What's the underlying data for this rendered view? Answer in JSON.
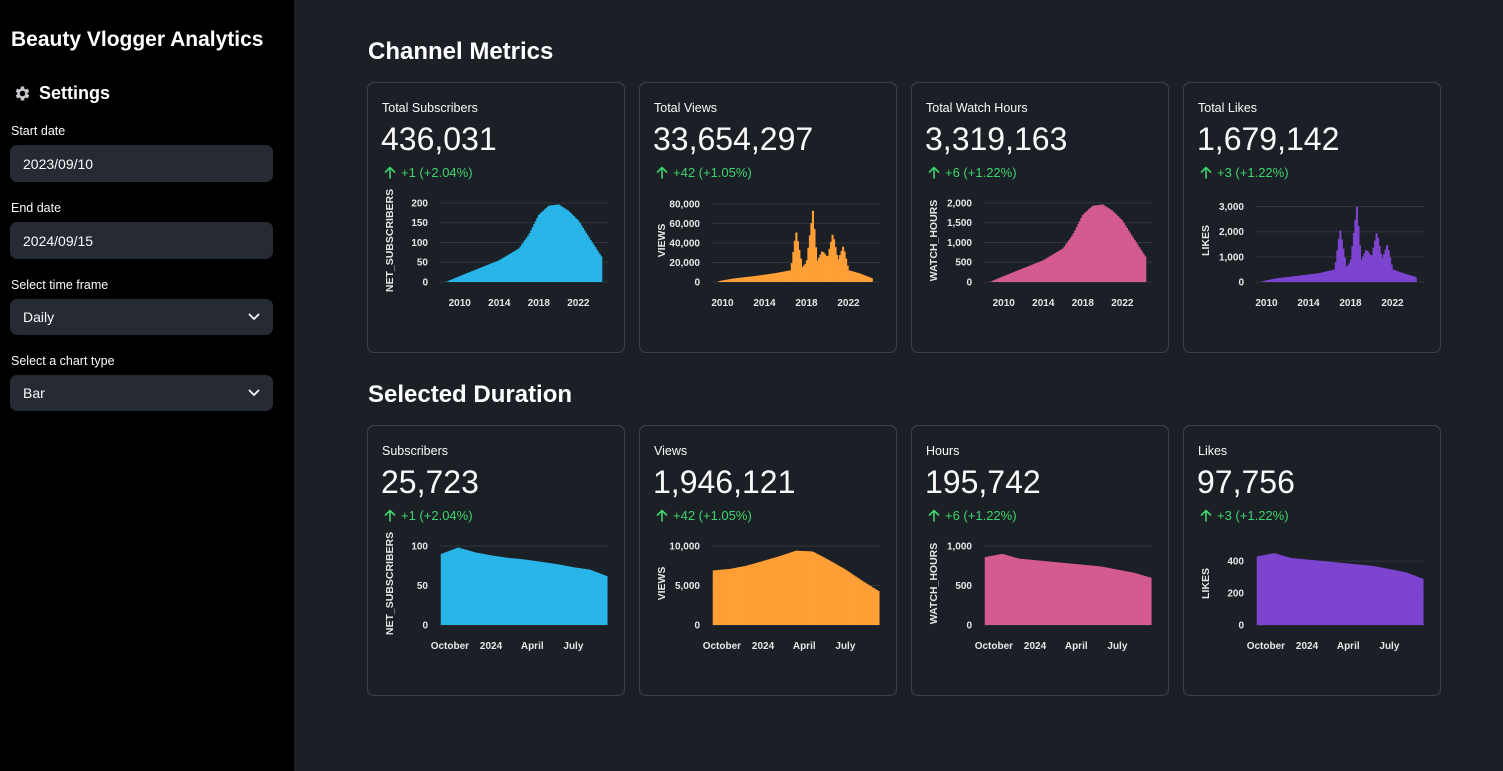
{
  "sidebar": {
    "title": "Beauty Vlogger Analytics",
    "settings_icon": "gear-icon",
    "settings_label": "Settings",
    "start_date_label": "Start date",
    "start_date_value": "2023/09/10",
    "end_date_label": "End date",
    "end_date_value": "2024/09/15",
    "time_frame_label": "Select time frame",
    "time_frame_value": "Daily",
    "chart_type_label": "Select a chart type",
    "chart_type_value": "Bar"
  },
  "sections": {
    "channel_metrics": "Channel Metrics",
    "selected_duration": "Selected Duration"
  },
  "colors": {
    "subscribers": "#29b5e8",
    "views": "#ff9f36",
    "hours": "#d45b90",
    "likes": "#7d44cf",
    "delta_up": "#3dd56d"
  },
  "channel_cards": [
    {
      "label": "Total Subscribers",
      "value": "436,031",
      "delta": "+1 (+2.04%)"
    },
    {
      "label": "Total Views",
      "value": "33,654,297",
      "delta": "+42 (+1.05%)"
    },
    {
      "label": "Total Watch Hours",
      "value": "3,319,163",
      "delta": "+6 (+1.22%)"
    },
    {
      "label": "Total Likes",
      "value": "1,679,142",
      "delta": "+3 (+1.22%)"
    }
  ],
  "duration_cards": [
    {
      "label": "Subscribers",
      "value": "25,723",
      "delta": "+1 (+2.04%)"
    },
    {
      "label": "Views",
      "value": "1,946,121",
      "delta": "+42 (+1.05%)"
    },
    {
      "label": "Hours",
      "value": "195,742",
      "delta": "+6 (+1.22%)"
    },
    {
      "label": "Likes",
      "value": "97,756",
      "delta": "+3 (+1.22%)"
    }
  ],
  "chart_data": [
    {
      "type": "bar",
      "metric": "subscribers",
      "color": "#29b5e8",
      "ylabel": "NET_SUBSCRIBERS",
      "ylim": [
        0,
        210
      ],
      "yticks": [
        0,
        50,
        100,
        150,
        200
      ],
      "ytick_labels": [
        "0",
        "50",
        "100",
        "150",
        "200"
      ],
      "xlim": [
        2008,
        2025
      ],
      "xticks": [
        2010,
        2014,
        2018,
        2022
      ],
      "xtick_labels": [
        "2010",
        "2014",
        "2018",
        "2022"
      ],
      "x": [
        2008.6,
        2010,
        2012,
        2014,
        2016,
        2017,
        2018,
        2019,
        2020,
        2021,
        2022,
        2023,
        2024.3
      ],
      "values": [
        0,
        15,
        35,
        55,
        85,
        120,
        170,
        193,
        196,
        180,
        155,
        115,
        65
      ]
    },
    {
      "type": "bar",
      "metric": "views",
      "color": "#ff9f36",
      "ylabel": "VIEWS",
      "ylim": [
        0,
        85000
      ],
      "yticks": [
        0,
        20000,
        40000,
        60000,
        80000
      ],
      "ytick_labels": [
        "0",
        "20,000",
        "40,000",
        "60,000",
        "80,000"
      ],
      "xlim": [
        2009,
        2025
      ],
      "xticks": [
        2010,
        2014,
        2018,
        2022
      ],
      "xtick_labels": [
        "2010",
        "2014",
        "2018",
        "2022"
      ],
      "x": [
        2009.7,
        2011,
        2013,
        2015,
        2016.5,
        2017,
        2017.6,
        2018,
        2018.6,
        2019,
        2019.5,
        2020,
        2020.5,
        2021,
        2021.5,
        2022,
        2023,
        2024.2
      ],
      "values": [
        1000,
        3500,
        6000,
        9000,
        12000,
        52000,
        15000,
        20000,
        73000,
        21000,
        32000,
        25000,
        50000,
        22000,
        37000,
        12000,
        9000,
        4000
      ]
    },
    {
      "type": "bar",
      "metric": "hours",
      "color": "#d45b90",
      "ylabel": "WATCH_HOURS",
      "ylim": [
        0,
        2100
      ],
      "yticks": [
        0,
        500,
        1000,
        1500,
        2000
      ],
      "ytick_labels": [
        "0",
        "500",
        "1,000",
        "1,500",
        "2,000"
      ],
      "xlim": [
        2008,
        2025
      ],
      "xticks": [
        2010,
        2014,
        2018,
        2022
      ],
      "xtick_labels": [
        "2010",
        "2014",
        "2018",
        "2022"
      ],
      "x": [
        2008.6,
        2010,
        2012,
        2014,
        2016,
        2017,
        2018,
        2019,
        2020,
        2021,
        2022,
        2023,
        2024.3
      ],
      "values": [
        0,
        150,
        350,
        550,
        850,
        1200,
        1700,
        1930,
        1960,
        1800,
        1550,
        1150,
        650
      ]
    },
    {
      "type": "bar",
      "metric": "likes",
      "color": "#7d44cf",
      "ylabel": "LIKES",
      "ylim": [
        0,
        3300
      ],
      "yticks": [
        0,
        1000,
        2000,
        3000
      ],
      "ytick_labels": [
        "0",
        "1,000",
        "2,000",
        "3,000"
      ],
      "xlim": [
        2009,
        2025
      ],
      "xticks": [
        2010,
        2014,
        2018,
        2022
      ],
      "xtick_labels": [
        "2010",
        "2014",
        "2018",
        "2022"
      ],
      "x": [
        2009.7,
        2011,
        2013,
        2015,
        2016.5,
        2017,
        2017.6,
        2018,
        2018.6,
        2019,
        2019.5,
        2020,
        2020.5,
        2021,
        2021.5,
        2022,
        2023,
        2024.2
      ],
      "values": [
        40,
        150,
        250,
        350,
        500,
        2100,
        600,
        800,
        3000,
        850,
        1300,
        1000,
        2000,
        900,
        1500,
        500,
        350,
        200
      ]
    },
    {
      "type": "bar",
      "metric": "subscribers",
      "color": "#29b5e8",
      "ylabel": "NET_SUBSCRIBERS",
      "ylim": [
        0,
        105
      ],
      "yticks": [
        0,
        50,
        100
      ],
      "ytick_labels": [
        "0",
        "50",
        "100"
      ],
      "xlim": [
        2023.69,
        2024.71
      ],
      "xticks": [
        2023.75,
        2024,
        2024.25,
        2024.5
      ],
      "xtick_labels": [
        "October",
        "2024",
        "April",
        "July"
      ],
      "x": [
        2023.7,
        2023.8,
        2023.9,
        2024.0,
        2024.1,
        2024.2,
        2024.3,
        2024.4,
        2024.5,
        2024.6,
        2024.7
      ],
      "values": [
        90,
        98,
        92,
        88,
        85,
        83,
        80,
        77,
        73,
        70,
        62
      ]
    },
    {
      "type": "bar",
      "metric": "views",
      "color": "#ff9f36",
      "ylabel": "VIEWS",
      "ylim": [
        0,
        10500
      ],
      "yticks": [
        0,
        5000,
        10000
      ],
      "ytick_labels": [
        "0",
        "5,000",
        "10,000"
      ],
      "xlim": [
        2023.69,
        2024.71
      ],
      "xticks": [
        2023.75,
        2024,
        2024.25,
        2024.5
      ],
      "xtick_labels": [
        "October",
        "2024",
        "April",
        "July"
      ],
      "x": [
        2023.7,
        2023.8,
        2023.9,
        2024.0,
        2024.1,
        2024.2,
        2024.3,
        2024.4,
        2024.5,
        2024.6,
        2024.7
      ],
      "values": [
        6900,
        7100,
        7500,
        8100,
        8700,
        9400,
        9300,
        8200,
        7000,
        5600,
        4300
      ]
    },
    {
      "type": "bar",
      "metric": "hours",
      "color": "#d45b90",
      "ylabel": "WATCH_HOURS",
      "ylim": [
        0,
        1050
      ],
      "yticks": [
        0,
        500,
        1000
      ],
      "ytick_labels": [
        "0",
        "500",
        "1,000"
      ],
      "xlim": [
        2023.69,
        2024.71
      ],
      "xticks": [
        2023.75,
        2024,
        2024.25,
        2024.5
      ],
      "xtick_labels": [
        "October",
        "2024",
        "April",
        "July"
      ],
      "x": [
        2023.7,
        2023.8,
        2023.9,
        2024.0,
        2024.1,
        2024.2,
        2024.3,
        2024.4,
        2024.5,
        2024.6,
        2024.7
      ],
      "values": [
        860,
        900,
        840,
        820,
        800,
        780,
        760,
        740,
        700,
        660,
        600
      ]
    },
    {
      "type": "bar",
      "metric": "likes",
      "color": "#7d44cf",
      "ylabel": "LIKES",
      "ylim": [
        0,
        520
      ],
      "yticks": [
        0,
        200,
        400
      ],
      "ytick_labels": [
        "0",
        "200",
        "400"
      ],
      "xlim": [
        2023.69,
        2024.71
      ],
      "xticks": [
        2023.75,
        2024,
        2024.25,
        2024.5
      ],
      "xtick_labels": [
        "October",
        "2024",
        "April",
        "July"
      ],
      "x": [
        2023.7,
        2023.8,
        2023.9,
        2024.0,
        2024.1,
        2024.2,
        2024.3,
        2024.4,
        2024.5,
        2024.6,
        2024.7
      ],
      "values": [
        430,
        450,
        420,
        410,
        400,
        390,
        380,
        370,
        350,
        330,
        290
      ]
    }
  ]
}
